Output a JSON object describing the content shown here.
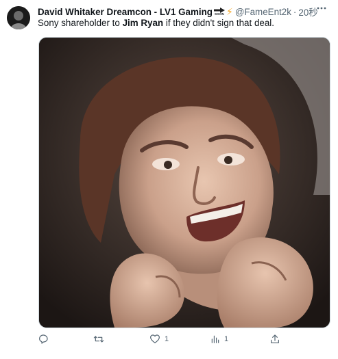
{
  "tweet": {
    "author_name": "David Whitaker Dreamcon - LV1 Gaming",
    "badge_text": "SOON",
    "handle": "@FameEnt2k",
    "separator": "·",
    "time": "20秒",
    "text_before": "Sony shareholder to ",
    "text_bold": "Jim Ryan",
    "text_after": " if they didn't sign that deal."
  },
  "actions": {
    "reply_count": "",
    "retweet_count": "",
    "like_count": "1",
    "views_count": "1"
  },
  "icons": [
    "avatar",
    "soon-arrow-icon",
    "lightning-bolt-icon",
    "more-icon",
    "reply-icon",
    "retweet-icon",
    "like-icon",
    "views-icon",
    "share-icon"
  ],
  "colors": {
    "text": "#0f1419",
    "secondary": "#536471",
    "bolt": "#f5a623"
  }
}
